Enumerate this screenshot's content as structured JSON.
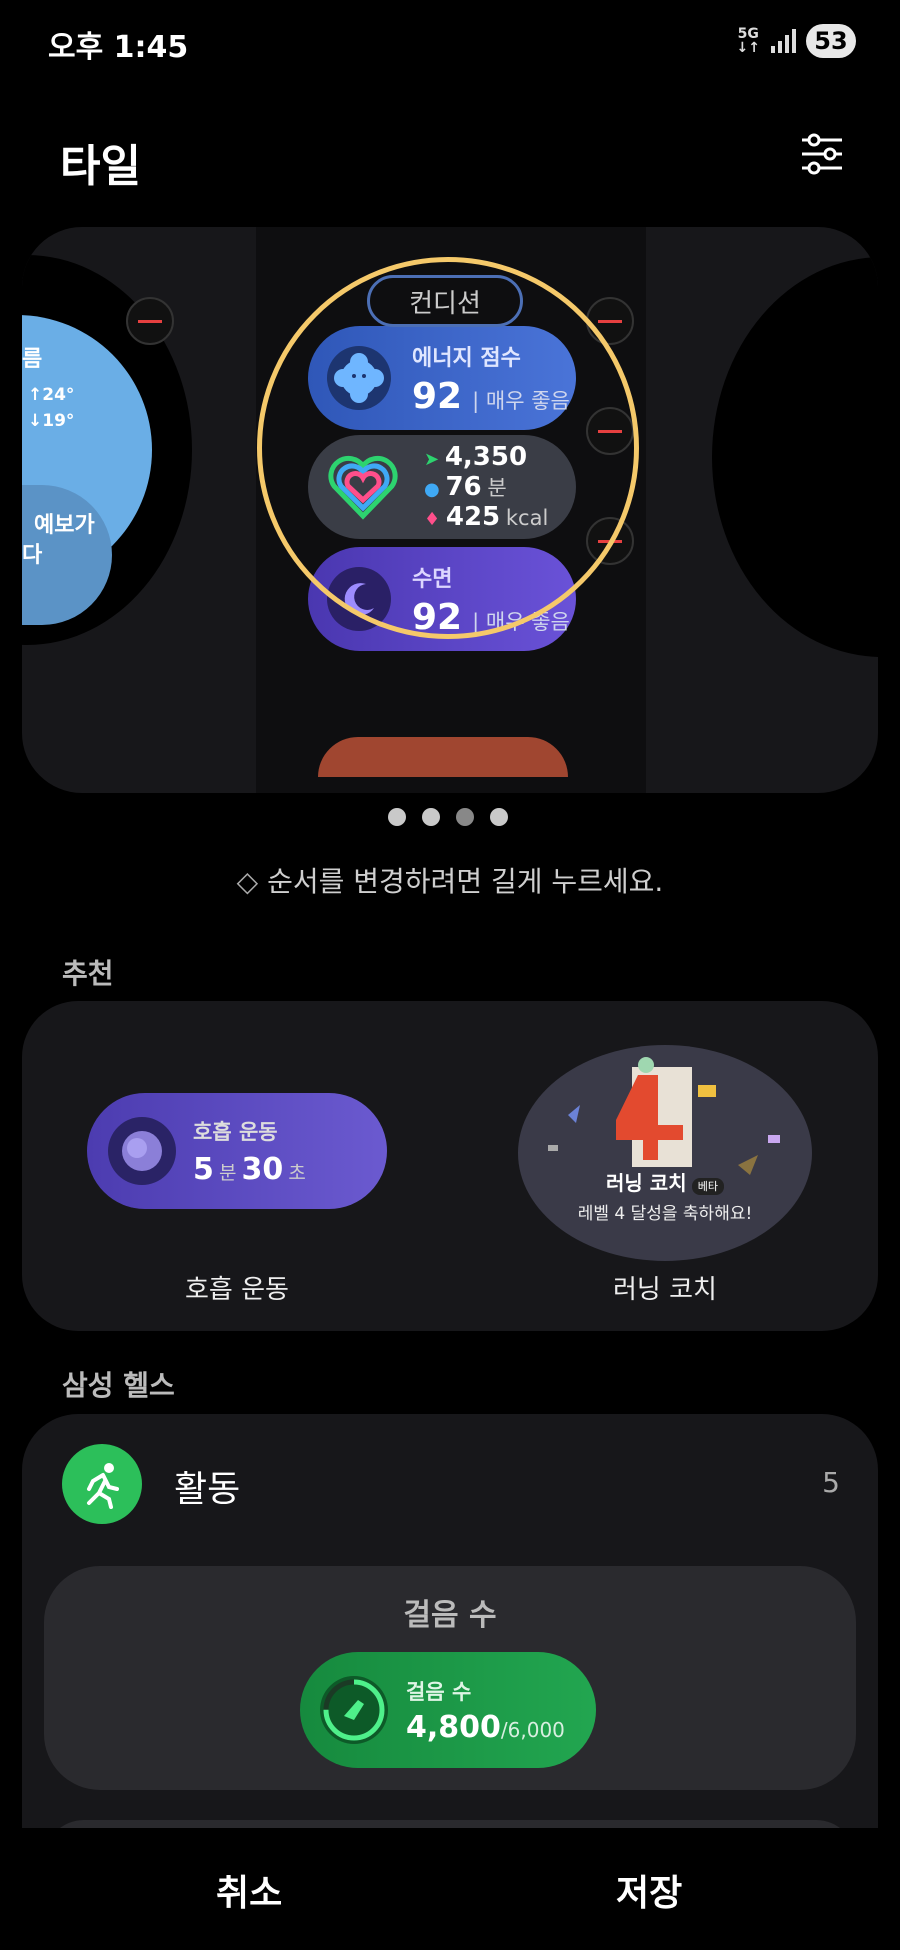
{
  "status_bar": {
    "time": "오후 1:45",
    "network_top": "5G",
    "network_bottom": "↓↑",
    "battery": "53"
  },
  "header": {
    "title": "타일"
  },
  "preview": {
    "condition_label": "컨디션",
    "left_tile": {
      "line1": "름",
      "temp_high": "↑24°",
      "temp_low": "↓19°",
      "line3": "예보가",
      "line4": "다"
    },
    "energy": {
      "label": "에너지 점수",
      "value": "92",
      "rating": "매우 좋음"
    },
    "activity": {
      "steps": "4,350",
      "minutes": "76",
      "minutes_unit": "분",
      "kcal": "425",
      "kcal_unit": "kcal"
    },
    "sleep": {
      "label": "수면",
      "value": "92",
      "rating": "매우 좋음"
    }
  },
  "page_indicator": {
    "count": 4,
    "active": 3
  },
  "hint": "순서를 변경하려면 길게 누르세요.",
  "recommended": {
    "section_title": "추천",
    "breathing": {
      "tile_title": "호흡 운동",
      "min": "5",
      "min_unit": "분",
      "sec": "30",
      "sec_unit": "초",
      "label": "호흡 운동"
    },
    "running": {
      "tile_title": "러닝 코치",
      "badge": "베타",
      "message": "레벨 4 달성을 축하해요!",
      "label": "러닝 코치"
    }
  },
  "samsung_health": {
    "section_title": "삼성 헬스",
    "activity_label": "활동",
    "activity_count": "5",
    "steps_card": {
      "title": "걸음 수",
      "tile_label": "걸음 수",
      "value": "4,800",
      "goal": "/6,000"
    }
  },
  "buttons": {
    "cancel": "취소",
    "save": "저장"
  },
  "colors": {
    "ring": "#f5c96a",
    "energy_tile": "#3a62c4",
    "sleep_tile": "#5c48c8",
    "steps_tile": "#1e9a48",
    "minus": "#e64040"
  }
}
